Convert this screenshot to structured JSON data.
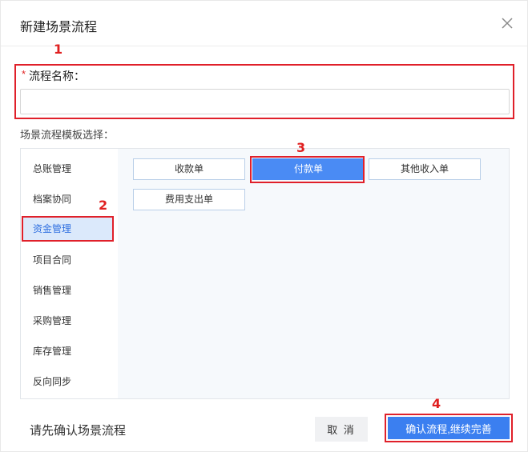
{
  "dialog": {
    "title": "新建场景流程",
    "close_icon": "close-icon"
  },
  "steps": {
    "s1": "1",
    "s2": "2",
    "s3": "3",
    "s4": "4"
  },
  "form": {
    "required_mark": "*",
    "name_label": "流程名称：",
    "name_value": "",
    "name_placeholder": "",
    "template_label": "场景流程模板选择："
  },
  "categories": [
    {
      "label": "总账管理",
      "active": false
    },
    {
      "label": "档案协同",
      "active": false
    },
    {
      "label": "资金管理",
      "active": true
    },
    {
      "label": "项目合同",
      "active": false
    },
    {
      "label": "销售管理",
      "active": false
    },
    {
      "label": "采购管理",
      "active": false
    },
    {
      "label": "库存管理",
      "active": false
    },
    {
      "label": "反向同步",
      "active": false
    }
  ],
  "templates": [
    {
      "label": "收款单",
      "selected": false
    },
    {
      "label": "付款单",
      "selected": true
    },
    {
      "label": "其他收入单",
      "selected": false
    },
    {
      "label": "费用支出单",
      "selected": false
    }
  ],
  "footer": {
    "hint": "请先确认场景流程",
    "cancel_label": "取 消",
    "confirm_label": "确认流程,继续完善"
  },
  "colors": {
    "accent": "#3b7ff0",
    "annotation_red": "#e0202a",
    "active_category_bg": "#dbe9fb"
  }
}
